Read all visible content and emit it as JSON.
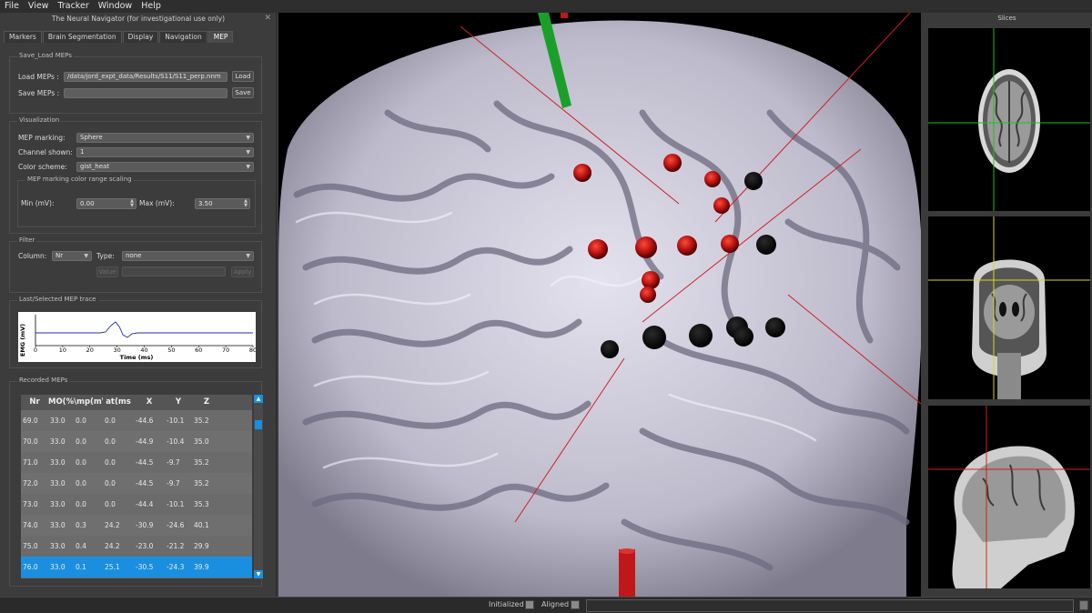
{
  "menu": [
    "File",
    "View",
    "Tracker",
    "Window",
    "Help"
  ],
  "app_title": "The Neural Navigator (for investigational use only)",
  "tabs": [
    "Markers",
    "Brain Segmentation",
    "Display",
    "Navigation",
    "MEP"
  ],
  "active_tab": "MEP",
  "save_load": {
    "title": "Save_Load MEPs",
    "load_label": "Load MEPs :",
    "load_path": "/data/jord_expt_data/Results/S11/S11_perp.nnm",
    "load_button": "Load",
    "save_label": "Save MEPs :",
    "save_path": "",
    "save_button": "Save"
  },
  "visualization": {
    "title": "Visualization",
    "marking_label": "MEP marking:",
    "marking_value": "Sphere",
    "channel_label": "Channel shown:",
    "channel_value": "1",
    "color_label": "Color scheme:",
    "color_value": "gist_heat",
    "range_title": "MEP marking color range scaling",
    "min_label": "Min (mV):",
    "min_value": "0.00",
    "max_label": "Max (mV):",
    "max_value": "3.50"
  },
  "filter": {
    "title": "Filter",
    "column_label": "Column:",
    "column_value": "Nr",
    "type_label": "Type:",
    "type_value": "none",
    "value_button": "Value",
    "value_field": "",
    "apply_button": "Apply"
  },
  "trace": {
    "title": "Last/Selected MEP trace",
    "ylabel": "EMG (mV)",
    "xlabel": "Time (ms)",
    "x_ticks": [
      "0",
      "10",
      "20",
      "30",
      "40",
      "50",
      "60",
      "70",
      "80"
    ],
    "color": "#2a2aa0"
  },
  "recorded": {
    "title": "Recorded MEPs",
    "columns": [
      "Nr",
      "MO(%)",
      "\\mp(mV",
      "at(ms",
      "X",
      "Y",
      "Z"
    ],
    "rows": [
      [
        "69.0",
        "33.0",
        "0.0",
        "0.0",
        "-44.6",
        "-10.1",
        "35.2"
      ],
      [
        "70.0",
        "33.0",
        "0.0",
        "0.0",
        "-44.9",
        "-10.4",
        "35.0"
      ],
      [
        "71.0",
        "33.0",
        "0.0",
        "0.0",
        "-44.5",
        "-9.7",
        "35.2"
      ],
      [
        "72.0",
        "33.0",
        "0.0",
        "0.0",
        "-44.5",
        "-9.7",
        "35.2"
      ],
      [
        "73.0",
        "33.0",
        "0.0",
        "0.0",
        "-44.4",
        "-10.1",
        "35.3"
      ],
      [
        "74.0",
        "33.0",
        "0.3",
        "24.2",
        "-30.9",
        "-24.6",
        "40.1"
      ],
      [
        "75.0",
        "33.0",
        "0.4",
        "24.2",
        "-23.0",
        "-21.2",
        "29.9"
      ],
      [
        "76.0",
        "33.0",
        "0.1",
        "25.1",
        "-30.5",
        "-24.3",
        "39.9"
      ]
    ],
    "selected_row": 7,
    "selection_color": "#1a8fe0"
  },
  "slices": {
    "title": "Slices"
  },
  "status": {
    "initialized_label": "Initialized",
    "aligned_label": "Aligned"
  },
  "colors": {
    "accent": "#1a8fe0",
    "surface": "#d4d2e0",
    "mep_red": "#b01010",
    "mep_black": "#050505",
    "tracker_green": "#1aa02a",
    "tracker_red": "#c01818"
  },
  "icons": [
    "close-icon",
    "dropdown-arrow-icon",
    "spin-arrows-icon",
    "scroll-up-icon",
    "scroll-down-icon",
    "status-checkbox-icon"
  ]
}
